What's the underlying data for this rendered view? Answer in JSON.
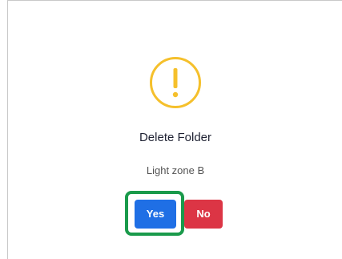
{
  "dialog": {
    "title": "Delete Folder",
    "subtitle": "Light zone B",
    "icon": "warning-exclamation-icon",
    "buttons": {
      "yes_label": "Yes",
      "no_label": "No"
    },
    "colors": {
      "warning": "#f5c02c",
      "confirm": "#1f6fe5",
      "cancel": "#dc3545",
      "focus_highlight": "#1a9a4b"
    }
  }
}
